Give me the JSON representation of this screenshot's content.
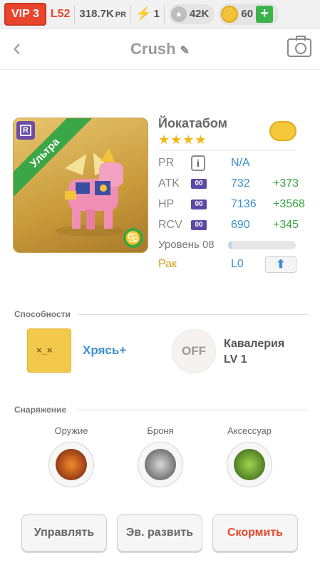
{
  "status_bar": {
    "vip": "VIP 3",
    "level": "L52",
    "pr_value": "318.7K",
    "pr_unit": "PR",
    "energy": "1",
    "paws": "42K",
    "coins": "60",
    "icons": [
      "bolt-icon",
      "paw-icon",
      "coin-icon",
      "plus-icon"
    ]
  },
  "nav": {
    "title": "Crush",
    "icons": [
      "back-icon",
      "edit-icon",
      "camera-icon"
    ]
  },
  "pet": {
    "rarity": "Ультра",
    "name": "Йокатабом",
    "stars": "★★★★",
    "star_count": 4,
    "stats": {
      "pr": {
        "label": "PR",
        "info": "i",
        "value": "N/A"
      },
      "atk": {
        "label": "ATK",
        "badge": "00",
        "value": "732",
        "bonus": "+373"
      },
      "hp": {
        "label": "HP",
        "badge": "00",
        "value": "7136",
        "bonus": "+3568"
      },
      "rcv": {
        "label": "RCV",
        "badge": "00",
        "value": "690",
        "bonus": "+345"
      }
    },
    "level_label": "Уровень 08",
    "level_progress": 0.05,
    "rank_label": "Рак",
    "rank_value": "L0"
  },
  "abilities": {
    "title": "Способности",
    "items": [
      {
        "name": "Хрясь+",
        "icon": "ability-hit-icon"
      },
      {
        "state": "OFF",
        "name_line1": "Кавалерия",
        "name_line2": "LV 1",
        "icon": "cavalry-icon"
      }
    ]
  },
  "equipment": {
    "title": "Снаряжение",
    "slots": [
      {
        "label": "Оружие",
        "icon": "weapon-icon",
        "color": "#b6321c"
      },
      {
        "label": "Броня",
        "icon": "armor-icon",
        "color": "#6a6a6a"
      },
      {
        "label": "Аксессуар",
        "icon": "accessory-icon",
        "color": "#3f8a2a"
      }
    ]
  },
  "actions": {
    "manage": "Управлять",
    "evolve": "Эв. развить",
    "feed": "Скормить"
  }
}
